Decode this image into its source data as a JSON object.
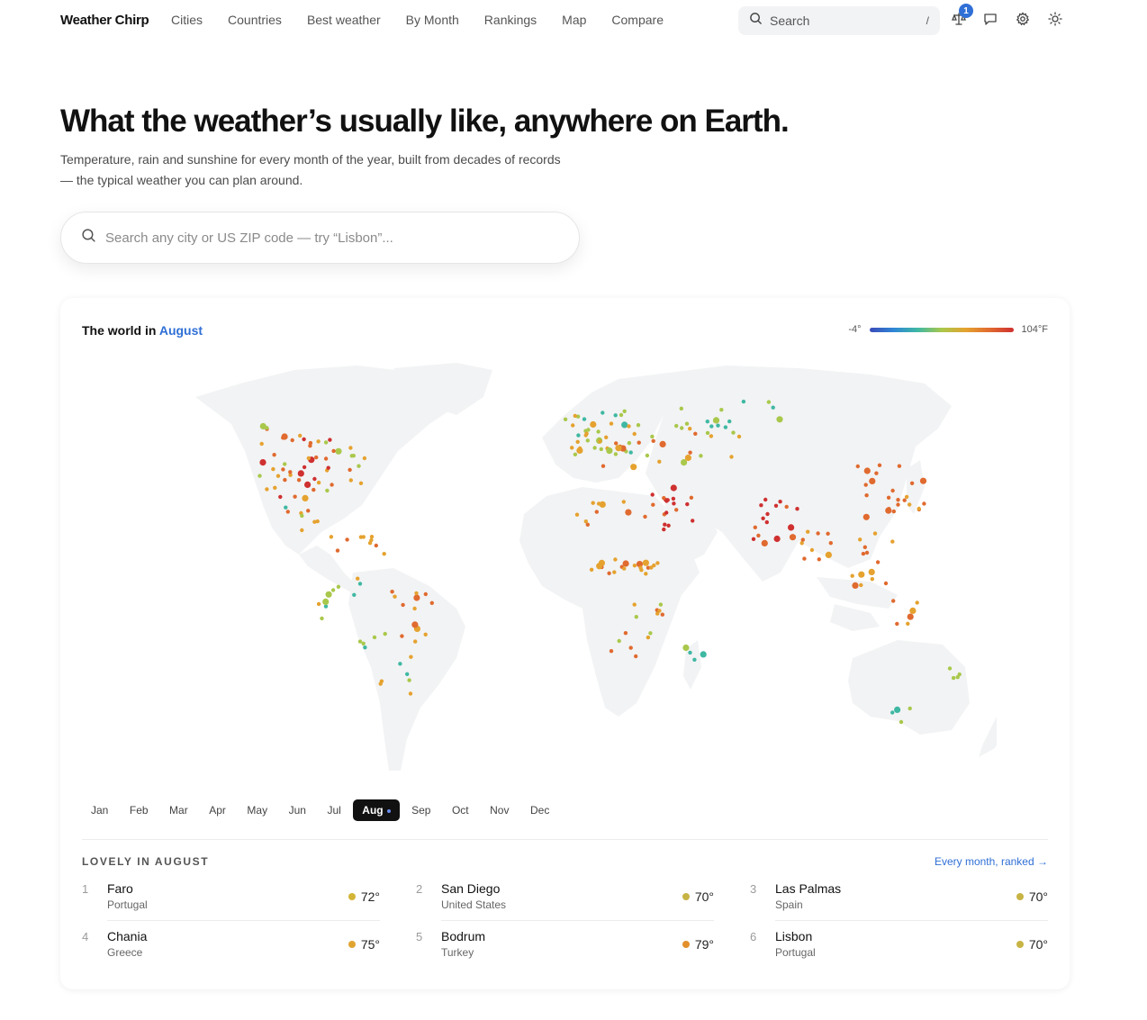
{
  "nav": {
    "brand": "Weather Chirp",
    "links": [
      "Cities",
      "Countries",
      "Best weather",
      "By Month",
      "Rankings",
      "Map",
      "Compare"
    ],
    "search_label": "Search",
    "search_kbd": "/",
    "compare_badge": "1"
  },
  "hero": {
    "title": "What the weather’s usually like, anywhere on Earth.",
    "subtitle": "Temperature, rain and sunshine for every month of the year, built from decades of records — the typical weather you can plan around.",
    "search_placeholder": "Search any city or US ZIP code — try “Lisbon”..."
  },
  "map_card": {
    "title_prefix": "The world in",
    "title_month": "August",
    "legend_min": "-4°",
    "legend_max": "104°F",
    "months": [
      "Jan",
      "Feb",
      "Mar",
      "Apr",
      "May",
      "Jun",
      "Jul",
      "Aug",
      "Sep",
      "Oct",
      "Nov",
      "Dec"
    ],
    "selected_month": "Aug"
  },
  "lovely": {
    "heading": "LOVELY IN AUGUST",
    "link": "Every month, ranked →",
    "cities": [
      {
        "rank": "1",
        "name": "Faro",
        "country": "Portugal",
        "temp": "72°",
        "color": "#d4b437"
      },
      {
        "rank": "2",
        "name": "San Diego",
        "country": "United States",
        "temp": "70°",
        "color": "#c7b445"
      },
      {
        "rank": "3",
        "name": "Las Palmas",
        "country": "Spain",
        "temp": "70°",
        "color": "#c7b445"
      },
      {
        "rank": "4",
        "name": "Chania",
        "country": "Greece",
        "temp": "75°",
        "color": "#e0a530"
      },
      {
        "rank": "5",
        "name": "Bodrum",
        "country": "Turkey",
        "temp": "79°",
        "color": "#e3902c"
      },
      {
        "rank": "6",
        "name": "Lisbon",
        "country": "Portugal",
        "temp": "70°",
        "color": "#c7b445"
      }
    ]
  },
  "colors": {
    "accent": "#2f6fd6",
    "scale": [
      "#3b4bb8",
      "#2f86d6",
      "#3fb8a3",
      "#a9c84b",
      "#e5a22f",
      "#e06a2f",
      "#cf3030"
    ]
  }
}
